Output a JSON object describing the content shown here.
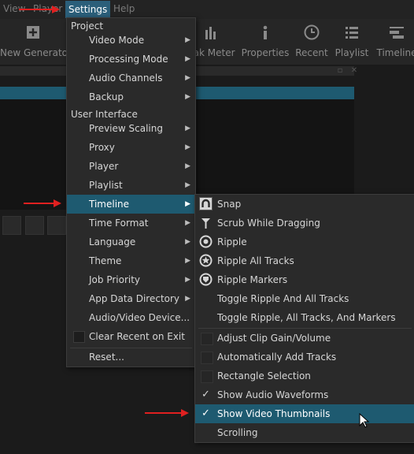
{
  "menubar": {
    "view": "View",
    "player": "Player",
    "settings": "Settings",
    "help": "Help"
  },
  "toolbar": {
    "new_generator": "New Generator",
    "peak_meter": "Peak Meter",
    "properties": "Properties",
    "recent": "Recent",
    "playlist": "Playlist",
    "timeline": "Timeline"
  },
  "settings_menu": {
    "project_heading": "Project",
    "video_mode": "Video Mode",
    "processing_mode": "Processing Mode",
    "audio_channels": "Audio Channels",
    "backup": "Backup",
    "ui_heading": "User Interface",
    "preview_scaling": "Preview Scaling",
    "proxy": "Proxy",
    "player": "Player",
    "playlist": "Playlist",
    "timeline": "Timeline",
    "time_format": "Time Format",
    "language": "Language",
    "theme": "Theme",
    "job_priority": "Job Priority",
    "app_data_directory": "App Data Directory",
    "audio_video_device": "Audio/Video Device...",
    "clear_recent": "Clear Recent on Exit",
    "reset": "Reset..."
  },
  "timeline_submenu": {
    "snap": "Snap",
    "scrub": "Scrub While Dragging",
    "ripple": "Ripple",
    "ripple_all": "Ripple All Tracks",
    "ripple_markers": "Ripple Markers",
    "toggle_ripple_all": "Toggle Ripple And All Tracks",
    "toggle_ripple_markers": "Toggle Ripple, All Tracks, And Markers",
    "adjust_gain": "Adjust Clip Gain/Volume",
    "auto_add_tracks": "Automatically Add Tracks",
    "rect_selection": "Rectangle Selection",
    "show_waveforms": "Show Audio Waveforms",
    "show_thumbnails": "Show Video Thumbnails",
    "scrolling": "Scrolling"
  },
  "colors": {
    "highlight": "#1e5a70",
    "menu_bg": "#2a2a2a",
    "annotation_arrow": "#e02020"
  }
}
